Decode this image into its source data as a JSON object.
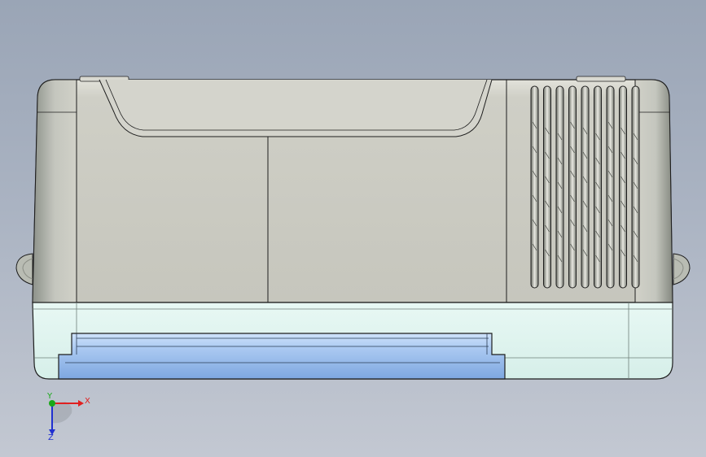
{
  "triad": {
    "x_label": "X",
    "y_label": "Y",
    "z_label": "Z",
    "x_color": "#e02020",
    "y_color": "#18a818",
    "z_color": "#2030d0"
  },
  "model": {
    "body_color": "#c9c9c1",
    "base_color": "#dff3ee",
    "drawer_color": "#8fb6ea",
    "outline_color": "#1e1e1e"
  }
}
